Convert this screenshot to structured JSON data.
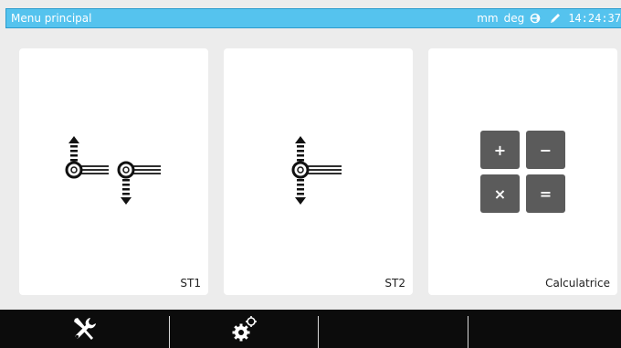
{
  "header": {
    "title": "Menu principal",
    "unit_length": "mm",
    "unit_angle": "deg",
    "status_icons": [
      "login-icon",
      "pencil-icon"
    ],
    "clock": "14:24:37"
  },
  "tiles": [
    {
      "label": "ST1",
      "icon": "dual-probe-st1-icon"
    },
    {
      "label": "ST2",
      "icon": "single-probe-st2-icon"
    },
    {
      "label": "Calculatrice",
      "icon": "calculator-icon"
    }
  ],
  "calculator_keys": [
    "+",
    "−",
    "×",
    "="
  ],
  "toolbar": {
    "items": [
      "tools-icon",
      "settings-gears-icon",
      "",
      ""
    ]
  },
  "colors": {
    "header": "#55c3ee",
    "background": "#ececec",
    "card": "#ffffff",
    "key": "#5b5b5b",
    "toolbar": "#0c0c0c"
  }
}
